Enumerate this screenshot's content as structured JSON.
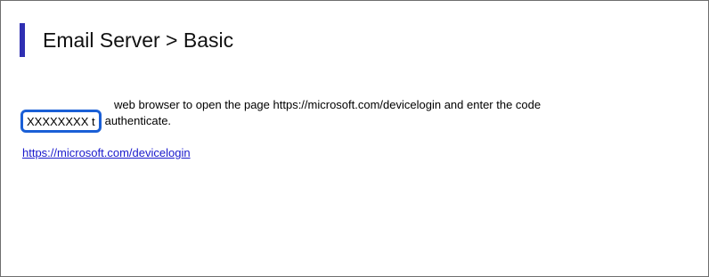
{
  "header": {
    "title": "Email Server > Basic",
    "accent_color": "#2f2fb2"
  },
  "instructions": {
    "line1_visible": "web browser to open the page https://microsoft.com/devicelogin and enter the code",
    "code": "XXXXXXXX t",
    "line2_tail": "authenticate."
  },
  "link": {
    "text": "https://microsoft.com/devicelogin",
    "color": "#1a1acc"
  },
  "highlight": {
    "color": "#1a5fd6"
  }
}
